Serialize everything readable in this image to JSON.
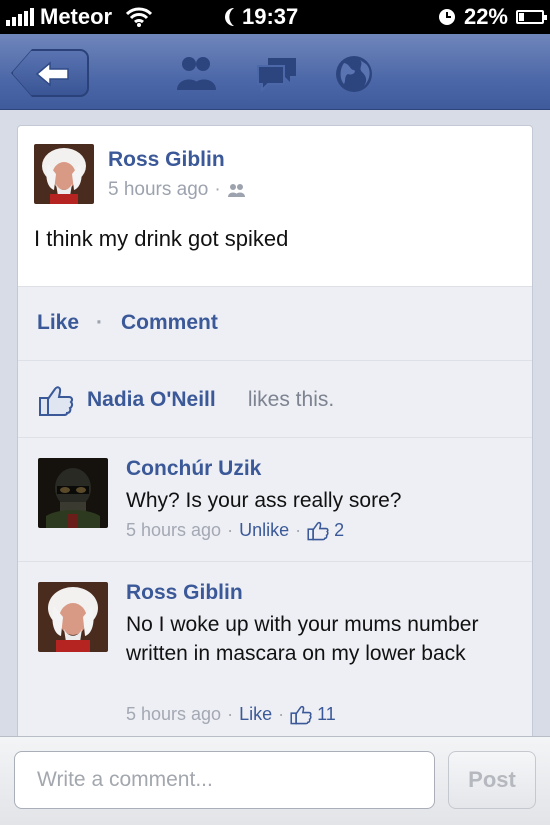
{
  "status_bar": {
    "carrier": "Meteor",
    "time": "19:37",
    "battery": "22%",
    "battery_level": 0.22
  },
  "nav": {
    "icons": [
      "back-arrow-icon",
      "friends-icon",
      "messages-icon",
      "globe-icon"
    ]
  },
  "post": {
    "author": "Ross Giblin",
    "time": "5 hours ago",
    "separator": "·",
    "audience_icon": "friends-icon",
    "text": "I think my drink got spiked",
    "actions": {
      "like_label": "Like",
      "comment_label": "Comment",
      "separator": "·"
    },
    "likes": {
      "liker": "Nadia O'Neill",
      "suffix": " likes this."
    }
  },
  "comments": [
    {
      "author": "Conchúr Uzik",
      "text": "Why? Is your ass really sore?",
      "time": "5 hours ago",
      "action_label": "Unlike",
      "like_count": "2"
    },
    {
      "author": "Ross Giblin",
      "text": "No I woke up with your mums number written in mascara on my lower back",
      "time": "5 hours ago",
      "action_label": "Like",
      "like_count": "11"
    }
  ],
  "composer": {
    "placeholder": "Write a comment...",
    "post_label": "Post"
  },
  "colors": {
    "brand": "#3b5998",
    "navbar": "#4d68a8",
    "muted_text": "#9da3ae"
  }
}
